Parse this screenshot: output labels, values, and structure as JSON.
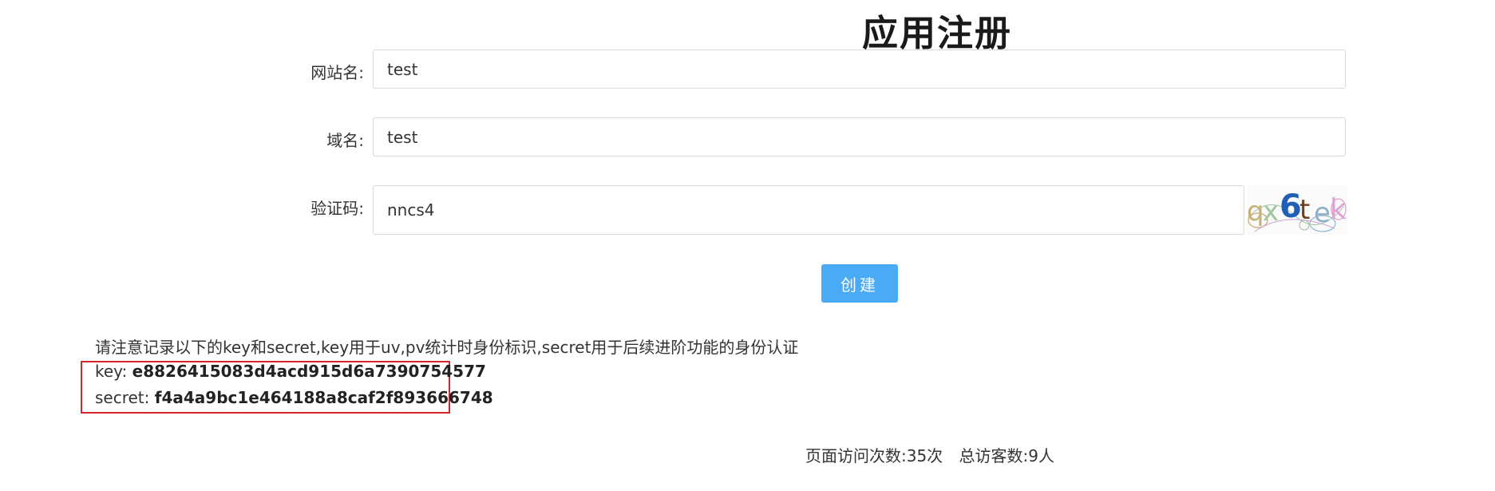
{
  "page": {
    "title": "应用注册"
  },
  "form": {
    "site_name": {
      "label": "网站名:",
      "value": "test"
    },
    "domain": {
      "label": "域名:",
      "value": "test"
    },
    "captcha": {
      "label": "验证码:",
      "value": "nncs4",
      "image_text": "qx6tek"
    },
    "submit_label": "创建"
  },
  "result": {
    "notice": "请注意记录以下的key和secret,key用于uv,pv统计时身份标识,secret用于后续进阶功能的身份认证",
    "key_label": "key:",
    "key_value": "e8826415083d4acd915d6a7390754577",
    "secret_label": "secret:",
    "secret_value": "f4a4a9bc1e464188a8caf2f893666748",
    "highlight_color": "#d9262c"
  },
  "footer": {
    "page_visits": "页面访问次数:35次",
    "total_visitors": "总访客数:9人"
  },
  "colors": {
    "button": "#49aaf5",
    "border": "#d9d9d9"
  }
}
